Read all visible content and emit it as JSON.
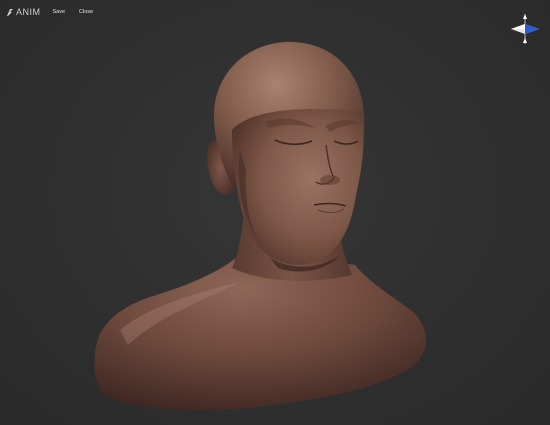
{
  "app": {
    "name": "ANIM",
    "logo_icon": "anim-logo-icon"
  },
  "toolbar": {
    "save_label": "Save",
    "close_label": "Close"
  },
  "viewport": {
    "background": "#2e2e2e",
    "model": "sculpted-head-bust",
    "skin_color": "#7a5548",
    "gizmo_icon": "orientation-gizmo-icon",
    "gizmo_colors": {
      "x_axis": "#ffffff",
      "y_axis": "#ffffff",
      "z_axis": "#2a5fd8"
    }
  }
}
